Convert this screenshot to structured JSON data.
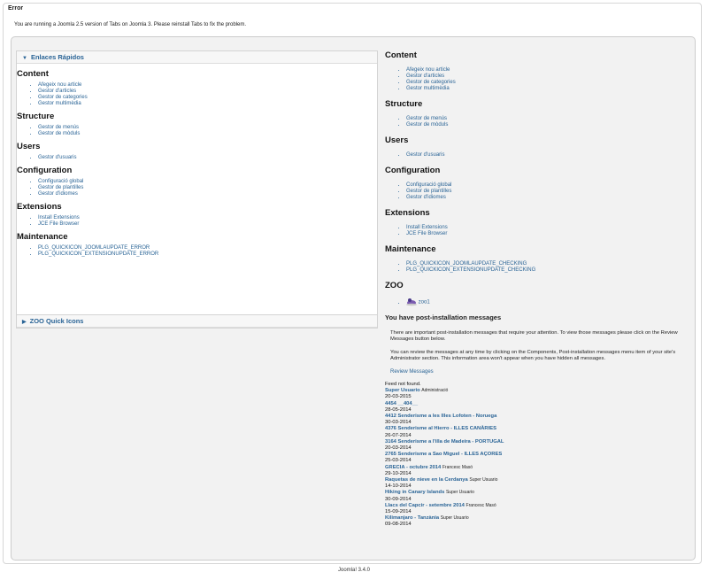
{
  "error": {
    "title": "Error",
    "message": "You are running a Joomla 2.5 version of Tabs on Joomla 3. Please reinstall Tabs to fix the problem."
  },
  "left": {
    "accordion_title": "Enlaces Rápidos",
    "accordion2_title": "ZOO Quick Icons",
    "sections": [
      {
        "title": "Content",
        "items": [
          "Afegeix nou article",
          "Gestor d'articles",
          "Gestor de categories",
          "Gestor multimèdia"
        ]
      },
      {
        "title": "Structure",
        "items": [
          "Gestor de menús",
          "Gestor de mòduls"
        ]
      },
      {
        "title": "Users",
        "items": [
          "Gestor d'usuaris"
        ]
      },
      {
        "title": "Configuration",
        "items": [
          "Configuració global",
          "Gestor de plantilles",
          "Gestor d'idiomes"
        ]
      },
      {
        "title": "Extensions",
        "items": [
          "Install Extensions",
          "JCE File Browser"
        ]
      },
      {
        "title": "Maintenance",
        "items": [
          "PLG_QUICKICON_JOOMLAUPDATE_ERROR",
          "PLG_QUICKICON_EXTENSIONUPDATE_ERROR"
        ]
      }
    ]
  },
  "right": {
    "sections": [
      {
        "title": "Content",
        "items": [
          "Afegeix nou article",
          "Gestor d'articles",
          "Gestor de categories",
          "Gestor multimèdia"
        ]
      },
      {
        "title": "Structure",
        "items": [
          "Gestor de menús",
          "Gestor de mòduls"
        ]
      },
      {
        "title": "Users",
        "items": [
          "Gestor d'usuaris"
        ]
      },
      {
        "title": "Configuration",
        "items": [
          "Configuració global",
          "Gestor de plantilles",
          "Gestor d'idiomes"
        ]
      },
      {
        "title": "Extensions",
        "items": [
          "Install Extensions",
          "JCE File Browser"
        ]
      },
      {
        "title": "Maintenance",
        "items": [
          "PLG_QUICKICON_JOOMLAUPDATE_CHECKING",
          "PLG_QUICKICON_EXTENSIONUPDATE_CHECKING"
        ]
      }
    ],
    "zoo_title": "ZOO",
    "zoo_item": "zoo1",
    "postinstall": {
      "title": "You have post-installation messages",
      "p1": "There are important post-installation messages that require your attention. To view those messages please click on the Review Messages button below.",
      "p2": "You can review the messages at any time by clicking on the Components, Post-installation messages menu item of your site's Administrator section. This information area won't appear when you have hidden all messages.",
      "review": "Review Messages"
    },
    "feed_error": "Feed not found.",
    "feed": [
      {
        "title": "Super Usuario",
        "author": "Administració",
        "date": "20-03-2015"
      },
      {
        "title": "4454 __404__",
        "author": "",
        "date": "28-05-2014"
      },
      {
        "title": "4412 Senderisme a les Illes Lofoten - Noruega",
        "author": "",
        "date": "30-03-2014"
      },
      {
        "title": "4376 Senderisme al Hierro - ILLES CANÀRIES",
        "author": "",
        "date": "26-07-2014"
      },
      {
        "title": "3164 Senderisme a l'illa de Madeira - PORTUGAL",
        "author": "",
        "date": "20-03-2014"
      },
      {
        "title": "2765 Senderisme a Sao Miguel - ILLES AÇORES",
        "author": "",
        "date": "25-03-2014"
      },
      {
        "title": "GRECIA - octubre 2014",
        "author": "Francesc Masó",
        "date": "29-10-2014"
      },
      {
        "title": "Raquetas de nieve en la Cerdanya",
        "author": "Super Usuario",
        "date": "14-10-2014"
      },
      {
        "title": "Hiking in Canary Islands",
        "author": "Super Usuario",
        "date": "30-09-2014"
      },
      {
        "title": "Llacs del Capcir - setembre 2014",
        "author": "Francesc Masó",
        "date": "15-09-2014"
      },
      {
        "title": "Kilimanjaro - Tanzània",
        "author": "Super Usuario",
        "date": "09-08-2014"
      }
    ]
  },
  "footer": "Joomla! 3.4.0",
  "colors": {
    "link": "#2a6496",
    "panel": "#f2f2f2"
  }
}
